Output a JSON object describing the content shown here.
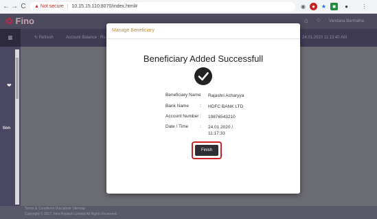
{
  "browser": {
    "not_secure_label": "Not secure",
    "url": "10.15.15.110:8070/index.html#",
    "back_glyph": "←",
    "forward_glyph": "→",
    "reload_glyph": "C"
  },
  "app_header": {
    "logo_text": "Fino",
    "user_name": "Vandana Barmaiha"
  },
  "toolbar": {
    "menu_glyph": "≡",
    "refresh_label": "Refresh",
    "account_balance_label": "Account Balance : Rs. 1",
    "datetime": "24.01.2020 11:13:40 AM"
  },
  "sidebar": {
    "partial_label": "tion"
  },
  "footer": {
    "links": "Terms & Conditions  Disclaimer  Sitemap",
    "copyright": "Copyright © 2017. Fino Paytech Limited All Rights Reserved."
  },
  "modal": {
    "title": "Manage Beneficiary",
    "success_message": "Beneficiary Added Successfull",
    "details": [
      {
        "label": "Beneficiary Name",
        "value": "Rajashri Acharyya"
      },
      {
        "label": "Bank Name",
        "value": "HDFC BANK LTD"
      },
      {
        "label": "Account Number",
        "value": "19876543210"
      },
      {
        "label": "Date / Time",
        "value_line1": "24.01.2020 /",
        "value_line2": "11:17:33"
      }
    ],
    "separator": ":",
    "finish_label": "Finish"
  },
  "colors": {
    "accent_title": "#c88a2c",
    "highlight_border": "#cc2222",
    "finish_bg": "#2f2f33"
  }
}
